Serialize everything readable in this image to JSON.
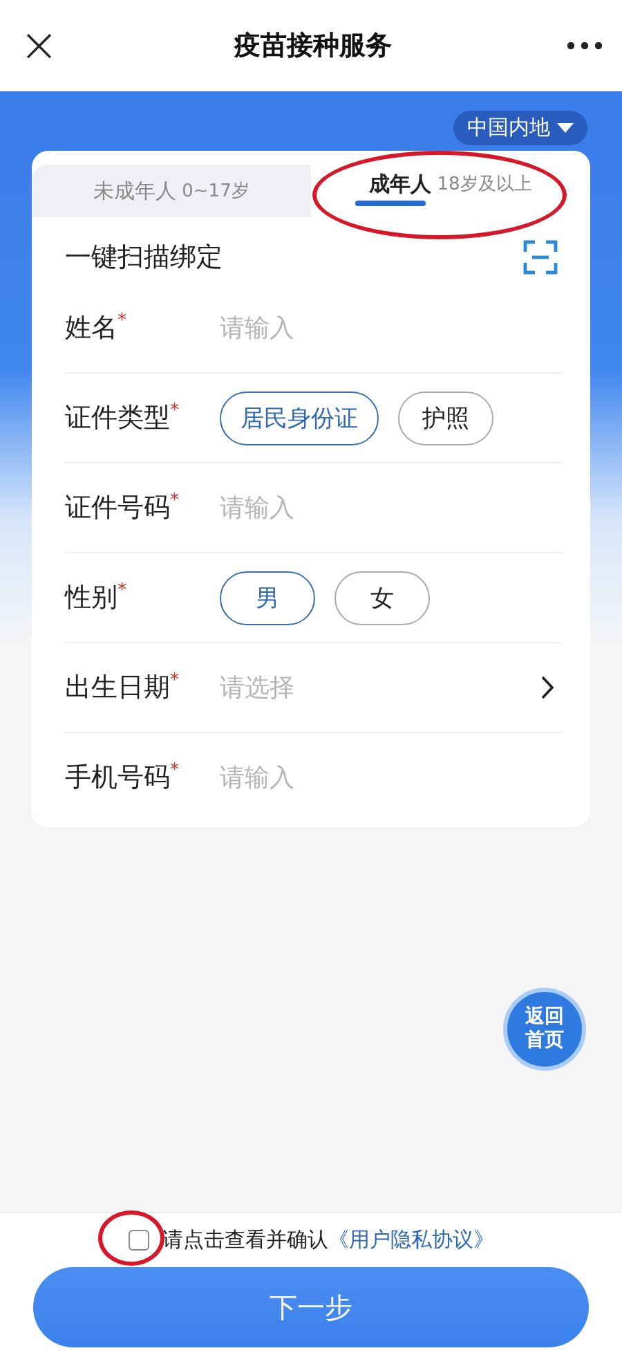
{
  "header": {
    "title": "疫苗接种服务",
    "close": "×"
  },
  "region": {
    "label": "中国内地"
  },
  "tabs": [
    {
      "label": "未成年人",
      "sub": "0~17岁",
      "selected": false,
      "circled": false
    },
    {
      "label": "成年人",
      "sub": "18岁及以上",
      "selected": true,
      "circled": true
    }
  ],
  "scan": {
    "label": "一键扫描绑定"
  },
  "fields": [
    {
      "kind": "input",
      "label": "姓名",
      "required_mark": "*",
      "placeholder": "请输入"
    },
    {
      "kind": "choice",
      "label": "证件类型",
      "required_mark": "*",
      "options": [
        {
          "label": "居民身份证",
          "selected": true
        },
        {
          "label": "护照",
          "selected": false
        }
      ]
    },
    {
      "kind": "input",
      "label": "证件号码",
      "required_mark": "*",
      "placeholder": "请输入"
    },
    {
      "kind": "choice",
      "label": "性别",
      "required_mark": "*",
      "options": [
        {
          "label": "男",
          "selected": true
        },
        {
          "label": "女",
          "selected": false
        }
      ]
    },
    {
      "kind": "select",
      "label": "出生日期",
      "required_mark": "*",
      "placeholder": "请选择"
    },
    {
      "kind": "input",
      "label": "手机号码",
      "required_mark": "*",
      "placeholder": "请输入"
    }
  ],
  "home_button": {
    "line1": "返回",
    "line2": "首页"
  },
  "agreement": {
    "checked": false,
    "circled": true,
    "text": "请点击查看并确认",
    "link": "《用户隐私协议》"
  },
  "next_button": {
    "label": "下一步"
  }
}
